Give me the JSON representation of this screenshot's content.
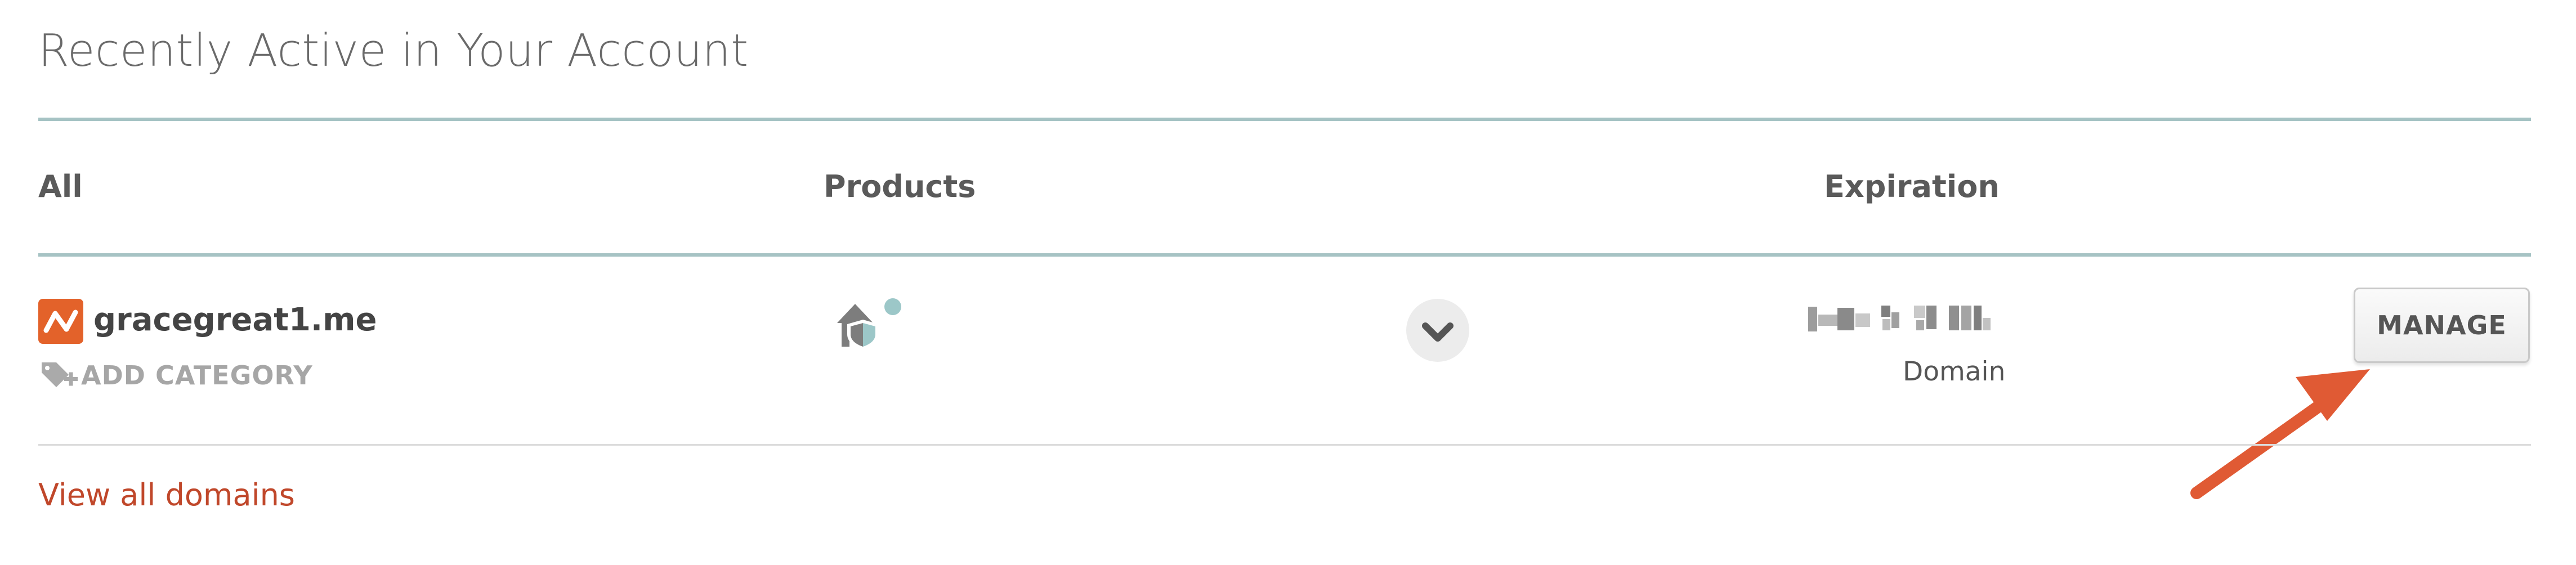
{
  "section": {
    "title": "Recently Active in Your Account"
  },
  "table": {
    "columns": {
      "all": "All",
      "products": "Products",
      "expiration": "Expiration"
    },
    "rows": [
      {
        "domain": "gracegreat1.me",
        "add_category_label": "ADD CATEGORY",
        "product_icon": "home-shield-icon",
        "expiration_type": "Domain",
        "manage_label": "MANAGE"
      }
    ]
  },
  "footer": {
    "view_all_label": "View all domains"
  },
  "colors": {
    "accent_rule": "#a6c3c4",
    "brand_orange": "#e3622a",
    "link_red": "#c0472a",
    "annotation_arrow": "#e05a34"
  },
  "icons": {
    "logo": "namecheap-logo-icon",
    "tag": "tag-plus-icon",
    "expand": "chevron-down-icon",
    "annotation": "arrow-annotation-icon"
  }
}
